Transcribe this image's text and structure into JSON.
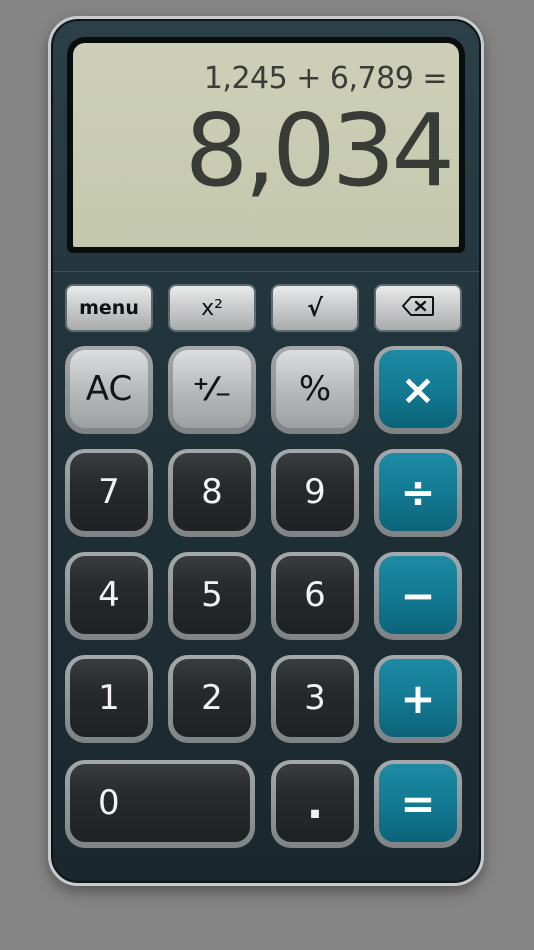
{
  "display": {
    "expression": "1,245 + 6,789 =",
    "result": "8,034"
  },
  "function_keys": [
    {
      "id": "menu",
      "label": "menu",
      "icon": ""
    },
    {
      "id": "square",
      "label": "x²",
      "icon": ""
    },
    {
      "id": "sqrt",
      "label": "√",
      "icon": ""
    },
    {
      "id": "backspace",
      "label": "",
      "icon": "backspace-icon"
    }
  ],
  "keys": {
    "ac": "AC",
    "plus_minus": "⁺⁄₋",
    "percent": "%",
    "multiply": "×",
    "seven": "7",
    "eight": "8",
    "nine": "9",
    "divide": "÷",
    "four": "4",
    "five": "5",
    "six": "6",
    "minus": "−",
    "one": "1",
    "two": "2",
    "three": "3",
    "plus": "+",
    "zero": "0",
    "decimal": ".",
    "equals": "="
  },
  "colors": {
    "body": "#1f3037",
    "lcd": "#c8cbb1",
    "operator_key": "#137a93",
    "number_key": "#272a2c",
    "gray_key": "#b8bbbc"
  }
}
